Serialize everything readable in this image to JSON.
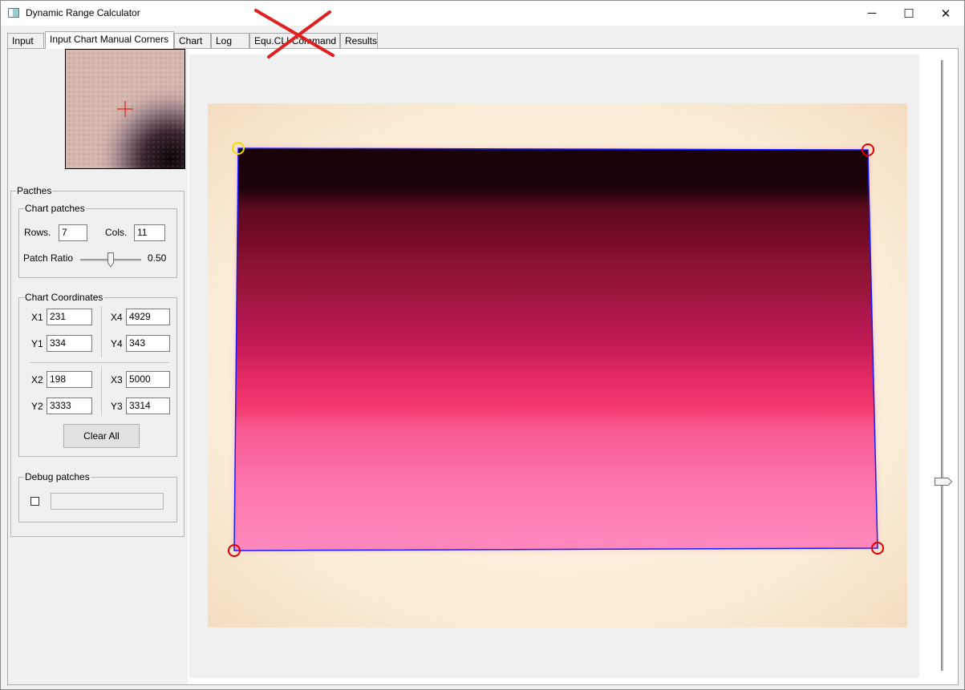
{
  "window": {
    "title": "Dynamic Range Calculator",
    "minimize_glyph": "─",
    "maximize_glyph": "☐",
    "close_glyph": "✕"
  },
  "tabs": [
    {
      "label": "Input"
    },
    {
      "label": "Input Chart Manual Corners",
      "active": true
    },
    {
      "label": "Chart"
    },
    {
      "label": "Log"
    },
    {
      "label": "Equ.CLI Command"
    },
    {
      "label": "Results"
    }
  ],
  "patches": {
    "legend": "Pacthes",
    "chart_patches": {
      "legend": "Chart patches",
      "rows_label": "Rows.",
      "rows_value": "7",
      "cols_label": "Cols.",
      "cols_value": "11",
      "ratio_label": "Patch Ratio",
      "ratio_value": "0.50",
      "ratio_fraction": 0.5
    },
    "coords": {
      "legend": "Chart Coordinates",
      "x1_label": "X1",
      "x1": "231",
      "y1_label": "Y1",
      "y1": "334",
      "x4_label": "X4",
      "x4": "4929",
      "y4_label": "Y4",
      "y4": "343",
      "x2_label": "X2",
      "x2": "198",
      "y2_label": "Y2",
      "y2": "3333",
      "x3_label": "X3",
      "x3": "5000",
      "y3_label": "Y3",
      "y3": "3314",
      "clear_label": "Clear All"
    },
    "debug": {
      "legend": "Debug patches",
      "checked": false,
      "value": ""
    }
  },
  "colors": {
    "chart_outline": "#1a1aff",
    "corner_marker": "#e00000",
    "active_corner_marker": "#f2e000"
  },
  "icons": {
    "crosshair": "crosshair-icon",
    "annotation_cross": "red-x-annotation"
  }
}
